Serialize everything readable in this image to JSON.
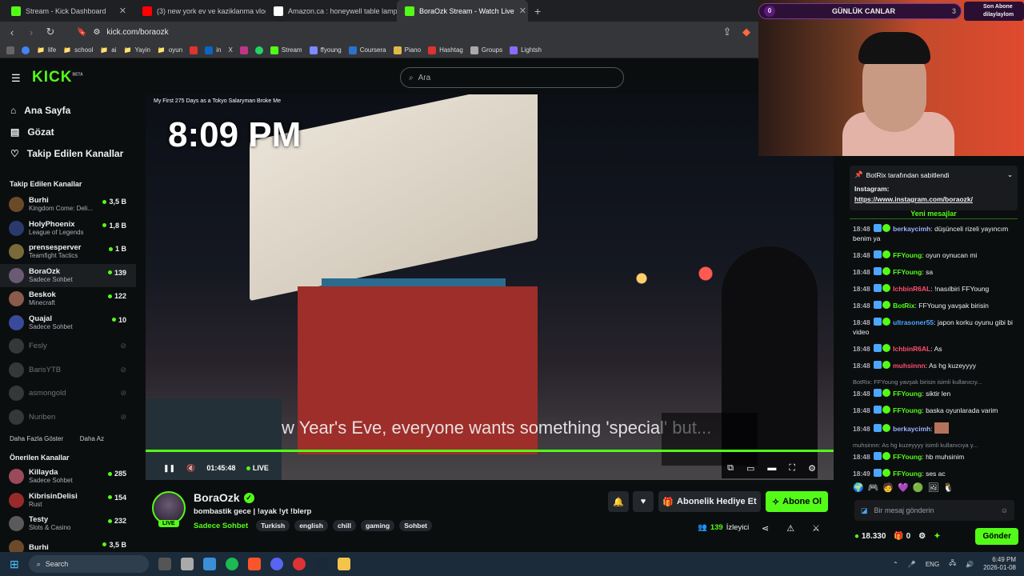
{
  "browser": {
    "tabs": [
      {
        "title": "Stream - Kick Dashboard",
        "color": "#53fc18"
      },
      {
        "title": "(3) new york ev ve kaziklanma vlogu",
        "color": "#ff0000"
      },
      {
        "title": "Amazon.ca : honeywell table lamp",
        "color": "#ffffff"
      },
      {
        "title": "BoraOzk Stream - Watch Live",
        "color": "#53fc18"
      }
    ],
    "url": "kick.com/boraozk",
    "bookmarks": [
      "life",
      "school",
      "ai",
      "Yayin",
      "oyun",
      "in",
      "X",
      "Stream",
      "ffyoung",
      "Coursera",
      "Piano",
      "Hashtag",
      "Groups",
      "Lightsh"
    ]
  },
  "kick": {
    "logo": "KICK",
    "logo_sup": "BETA",
    "search_placeholder": "Ara",
    "nav": [
      "Ana Sayfa",
      "Gözat",
      "Takip Edilen Kanallar"
    ],
    "followed_heading": "Takip Edilen Kanallar",
    "followed": [
      {
        "name": "Burhi",
        "game": "Kingdom Come: Deli...",
        "viewers": "3,5 B",
        "color": "#6b4a2a"
      },
      {
        "name": "HolyPhoenix",
        "game": "League of Legends",
        "viewers": "1,8 B",
        "color": "#2a3a6b"
      },
      {
        "name": "prensesperver",
        "game": "Teamfight Tactics",
        "viewers": "1 B",
        "color": "#7a6a3a"
      },
      {
        "name": "BoraOzk",
        "game": "Sadece Sohbet",
        "viewers": "139",
        "color": "#6b5a73"
      },
      {
        "name": "Beskok",
        "game": "Minecraft",
        "viewers": "122",
        "color": "#8a5a4a"
      },
      {
        "name": "Quajal",
        "game": "Sadece Sohbet",
        "viewers": "10",
        "color": "#3a4a9a"
      }
    ],
    "offline": [
      "Fesly",
      "BarisYTB",
      "asmongold",
      "Nuriben"
    ],
    "show_more": "Daha Fazla Göster",
    "show_less": "Daha Az",
    "recommended_heading": "Önerilen Kanallar",
    "recommended": [
      {
        "name": "Killayda",
        "game": "Sadece Sohbet",
        "viewers": "285",
        "color": "#9a4a5a"
      },
      {
        "name": "KibrisinDelisi",
        "game": "Rust",
        "viewers": "154",
        "color": "#9a2a2a"
      },
      {
        "name": "Testy",
        "game": "Slots & Casino",
        "viewers": "232",
        "color": "#5a5a5a"
      },
      {
        "name": "Burhi",
        "game": "",
        "viewers": "3,5 B",
        "color": "#6b4a2a"
      }
    ]
  },
  "video": {
    "title": "My First 275 Days as a Tokyo Salaryman Broke Me",
    "clock": "8:09 PM",
    "subtitle": "w Year's Eve, everyone wants something 'special' but...",
    "elapsed": "01:45:48",
    "live": "LIVE"
  },
  "stream": {
    "name": "BoraOzk",
    "title": "bombastik gece | !ayak !yt !blerp",
    "category": "Sadece Sohbet",
    "tags": [
      "Turkish",
      "english",
      "chill",
      "gaming",
      "Sohbet"
    ],
    "live_badge": "LIVE",
    "gift_label": "Abonelik Hediye Et",
    "sub_label": "Abone Ol",
    "viewers": "139",
    "viewers_label": "İzleyici"
  },
  "overlay": {
    "goal_count": "0",
    "goal_title": "GÜNLÜK CANLAR",
    "goal_max": "3",
    "last_sub_label": "Son Abone",
    "last_sub_name": "dilaylaylom"
  },
  "chat": {
    "pinned_by": "BotRix tarafından sabitlendi",
    "pinned_text": "Instagram:",
    "pinned_link": "https://www.instagram.com/boraozk/",
    "new_messages": "Yeni mesajlar",
    "messages": [
      {
        "time": "18:48",
        "user": "berkaycimh",
        "color": "#9ab0ff",
        "text": "düşünceli rizeli yayıncım benim ya"
      },
      {
        "time": "18:48",
        "user": "FFYoung",
        "color": "#53fc18",
        "text": "oyun oynucan mi"
      },
      {
        "time": "18:48",
        "user": "FFYoung",
        "color": "#53fc18",
        "text": "sa"
      },
      {
        "time": "18:48",
        "user": "IchbinR6AL",
        "color": "#ff4d6d",
        "text": "!nasılbiri FFYoung"
      },
      {
        "time": "18:48",
        "user": "BotRix",
        "color": "#53fc18",
        "text": "FFYoung yavşak birisin"
      },
      {
        "time": "18:48",
        "user": "ultrasoner55",
        "color": "#4da6ff",
        "text": "japon korku oyunu gibi bi video"
      },
      {
        "time": "18:48",
        "user": "IchbinR6AL",
        "color": "#ff4d6d",
        "text": "As"
      },
      {
        "time": "18:48",
        "user": "muhsinnn",
        "color": "#ff4d6d",
        "text": "As hg kuzeyyyy"
      },
      {
        "time": "18:48",
        "user": "FFYoung",
        "color": "#53fc18",
        "text": "siktir len",
        "reply": "BotRix: FFYoung yavşak birisin isimli kullanıcıy..."
      },
      {
        "time": "18:48",
        "user": "FFYoung",
        "color": "#53fc18",
        "text": "baska oyunlarada varim"
      },
      {
        "time": "18:48",
        "user": "berkaycimh",
        "color": "#9ab0ff",
        "text": ""
      },
      {
        "time": "18:48",
        "user": "FFYoung",
        "color": "#53fc18",
        "text": "hb muhsinim",
        "reply": "muhsinnn: As hg kuzeyyyy isimli kullanıcıya y..."
      },
      {
        "time": "18:49",
        "user": "FFYoung",
        "color": "#53fc18",
        "text": "ses ac"
      }
    ],
    "input_placeholder": "Bir mesaj gönderin",
    "points": "18.330",
    "gifts": "0",
    "send_label": "Gönder"
  },
  "taskbar": {
    "search": "Search",
    "lang": "ENG",
    "time": "6:49 PM",
    "date": "2026-01-08"
  }
}
